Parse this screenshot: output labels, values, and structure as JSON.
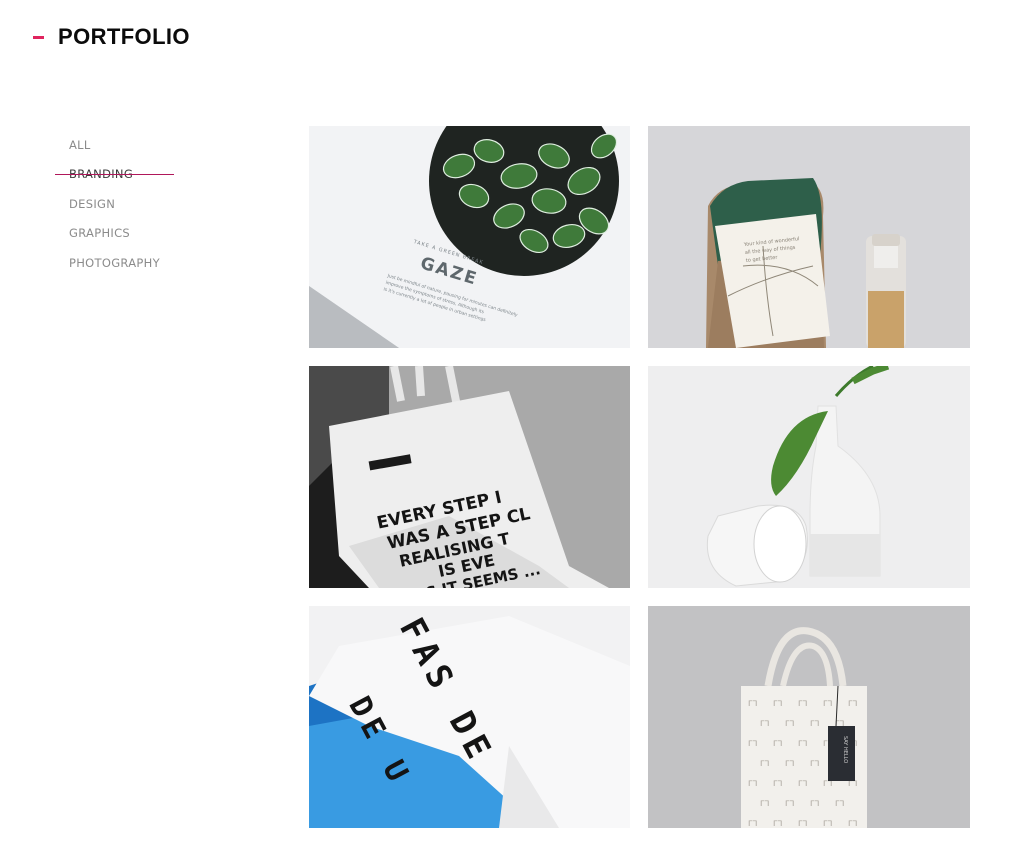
{
  "header": {
    "title": "PORTFOLIO",
    "accent_color": "#e0245e"
  },
  "filters": {
    "active_index": 1,
    "items": [
      {
        "label": "ALL"
      },
      {
        "label": "BRANDING"
      },
      {
        "label": "DESIGN"
      },
      {
        "label": "GRAPHICS"
      },
      {
        "label": "PHOTOGRAPHY"
      }
    ]
  },
  "portfolio": {
    "items": [
      {
        "id": "gaze",
        "kicker": "TAKE A GREEN BREAK",
        "brand": "GAZE",
        "body": [
          "Just be mindful of nature, pausing for minutes can definitely",
          "improve the symptoms of stress, Although its",
          "is it's currently a lot of people in urban settings"
        ]
      },
      {
        "id": "burlap-card",
        "card_lines": [
          "Your kind of wonderful",
          "all the way of things",
          "to get better"
        ]
      },
      {
        "id": "tote-every-step",
        "lines": [
          "EVERY STEP I",
          "WAS A STEP CL",
          "REALISING T",
          "IS EVE",
          "AS IT SEEMS ..."
        ]
      },
      {
        "id": "vase"
      },
      {
        "id": "fas-de-u",
        "lines": [
          "FAS DE",
          "DE U"
        ]
      },
      {
        "id": "tote-pattern",
        "tag_text": "SAY HELLO"
      }
    ]
  }
}
